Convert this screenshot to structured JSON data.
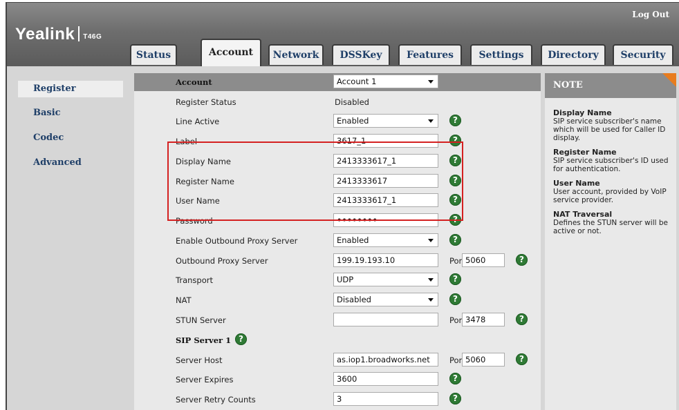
{
  "brand": {
    "name": "Yealink",
    "model": "T46G"
  },
  "header": {
    "logout": "Log Out"
  },
  "tabs": [
    {
      "label": "Status"
    },
    {
      "label": "Account"
    },
    {
      "label": "Network"
    },
    {
      "label": "DSSKey"
    },
    {
      "label": "Features"
    },
    {
      "label": "Settings"
    },
    {
      "label": "Directory"
    },
    {
      "label": "Security"
    }
  ],
  "active_tab": "Account",
  "sidebar": {
    "items": [
      {
        "label": "Register"
      },
      {
        "label": "Basic"
      },
      {
        "label": "Codec"
      },
      {
        "label": "Advanced"
      }
    ],
    "active": "Register"
  },
  "form": {
    "account": {
      "label": "Account",
      "value": "Account 1"
    },
    "register_status": {
      "label": "Register Status",
      "value": "Disabled"
    },
    "line_active": {
      "label": "Line Active",
      "value": "Enabled"
    },
    "label": {
      "label": "Label",
      "value": "3617_1"
    },
    "display_name": {
      "label": "Display Name",
      "value": "2413333617_1"
    },
    "register_name": {
      "label": "Register Name",
      "value": "2413333617"
    },
    "user_name": {
      "label": "User Name",
      "value": "2413333617_1"
    },
    "password": {
      "label": "Password",
      "value": "••••••••"
    },
    "outbound_proxy_enable": {
      "label": "Enable Outbound Proxy Server",
      "value": "Enabled"
    },
    "outbound_proxy": {
      "label": "Outbound Proxy Server",
      "value": "199.19.193.10",
      "port_label": "Port",
      "port": "5060"
    },
    "transport": {
      "label": "Transport",
      "value": "UDP"
    },
    "nat": {
      "label": "NAT",
      "value": "Disabled"
    },
    "stun": {
      "label": "STUN Server",
      "value": "",
      "port_label": "Port",
      "port": "3478"
    },
    "sip_server_1": {
      "label": "SIP Server 1"
    },
    "server_host": {
      "label": "Server Host",
      "value": "as.iop1.broadworks.net",
      "port_label": "Port",
      "port": "5060"
    },
    "server_expires": {
      "label": "Server Expires",
      "value": "3600"
    },
    "server_retry": {
      "label": "Server Retry Counts",
      "value": "3"
    }
  },
  "help_icon": "?",
  "note": {
    "title": "NOTE",
    "sections": [
      {
        "title": "Display Name",
        "text": "SIP service subscriber's name which will be used for Caller ID display."
      },
      {
        "title": "Register Name",
        "text": "SIP service subscriber's ID used for authentication."
      },
      {
        "title": "User Name",
        "text": "User account, provided by VoIP service provider."
      },
      {
        "title": "NAT Traversal",
        "text": "Defines the STUN server will be active or not."
      }
    ]
  },
  "colors": {
    "accent_orange": "#e87c1e",
    "help_green": "#2f7a35",
    "highlight_red": "#d42020",
    "link_blue": "#1f3f68"
  }
}
